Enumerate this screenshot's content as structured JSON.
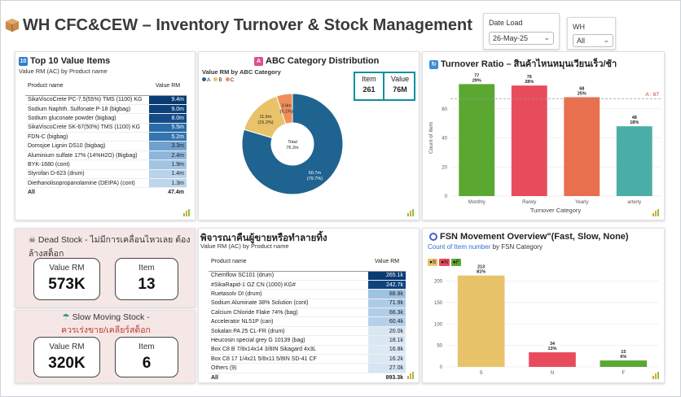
{
  "header": {
    "title": "WH CFC&CEW – Inventory Turnover & Stock Management",
    "icon": "box-icon"
  },
  "filters": {
    "date_label": "Date Load",
    "date_value": "26-May-25",
    "wh_label": "WH",
    "wh_value": "All"
  },
  "top10": {
    "title": "Top 10 Value Items",
    "subtitle": "Value RM (AC) by Product name",
    "col_product": "Product name",
    "col_value": "Value RM",
    "rows": [
      {
        "name": "SikaViscoCrete PC-7.5(55%) TMS (1100) KG",
        "value": "9.4m",
        "shade": "#0b3b73"
      },
      {
        "name": "Sodium Naphth. Sulfonate P-18 (bigbag)",
        "value": "9.0m",
        "shade": "#0e4079"
      },
      {
        "name": "Sodium gluconate powder (bigbag)",
        "value": "8.0m",
        "shade": "#134c87"
      },
      {
        "name": "SikaViscoCrete SK-67(50%) TMS (1100) KG",
        "value": "5.5m",
        "shade": "#2a6aa8"
      },
      {
        "name": "FDN-C (bigbag)",
        "value": "5.2m",
        "shade": "#3474b0"
      },
      {
        "name": "Domsjoe Lignin DS10 (bigbag)",
        "value": "3.3m",
        "shade": "#6fa1cf"
      },
      {
        "name": "Aluminium sulfate 17% (14%H2O) (Bigbag)",
        "value": "2.4m",
        "shade": "#8db6dc"
      },
      {
        "name": "BYK-1680 (cont)",
        "value": "1.9m",
        "shade": "#a3c5e4"
      },
      {
        "name": "Styrofan D-623 (drum)",
        "value": "1.4m",
        "shade": "#b8d3eb"
      },
      {
        "name": "Diethanolisopropanolamine (DEIPA) (cont)",
        "value": "1.3m",
        "shade": "#bcd6ec"
      }
    ],
    "total_label": "All",
    "total_value": "47.4m"
  },
  "abc": {
    "title": "ABC Category Distribution",
    "subtitle": "Value RM by ABC Category",
    "legend": [
      {
        "name": "A",
        "color": "#1f6391"
      },
      {
        "name": "B",
        "color": "#e8c36a"
      },
      {
        "name": "C",
        "color": "#ef8f5a"
      }
    ],
    "center_label": "Total",
    "center_value": "76.2m",
    "kpi_item_label": "Item",
    "kpi_item_value": "261",
    "kpi_value_label": "Value",
    "kpi_value_value": "76M"
  },
  "turnover": {
    "title": "Turnover Ratio – สินค้าไหนหมุนเวียนเร็ว/ช้า",
    "avg_label": "A : 67"
  },
  "dead_stock": {
    "title": "Dead Stock - ไม่มีการเคลื่อนไหวเลย ต้องล้างสต็อก",
    "value_label": "Value RM",
    "value": "573K",
    "item_label": "Item",
    "item_value": "13"
  },
  "slow_stock": {
    "title": "Slow Moving Stock -",
    "title2": "ควรเร่งขาย/เคลียร์สต็อก",
    "value_label": "Value RM",
    "value": "320K",
    "item_label": "Item",
    "item_value": "6"
  },
  "slow_table": {
    "title": "พิจารณาคืนผู้ขายหรือทำลายทิ้ง",
    "subtitle": "Value RM (AC) by Product name",
    "col_product": "Product name",
    "col_value": "Value RM",
    "rows": [
      {
        "name": "Chemflow SC101 (drum)",
        "value": "265.1k",
        "shade": "#0b3b73"
      },
      {
        "name": "#SikaRapid-1 GZ CN (1000) KG#",
        "value": "242.7k",
        "shade": "#0f437d"
      },
      {
        "name": "Ruetasolv DI (drum)",
        "value": "88.8k",
        "shade": "#9fc2e2"
      },
      {
        "name": "Sodium Aluminate 38% Solution (cont)",
        "value": "71.9k",
        "shade": "#accbe7"
      },
      {
        "name": "Calcium Chloride Flake 74% (bag)",
        "value": "66.3k",
        "shade": "#b0cee8"
      },
      {
        "name": "Accelerator NL51P (can)",
        "value": "60.4k",
        "shade": "#b5d1ea"
      },
      {
        "name": "Sokalan PA 25 CL-FR (drum)",
        "value": "20.0k",
        "shade": "#d8e7f4"
      },
      {
        "name": "Heucosin special grey G 10139 (bag)",
        "value": "18.1k",
        "shade": "#dae8f4"
      },
      {
        "name": "Box C8 B 7/8x14x14 3/8IN Sikagard 4x3L",
        "value": "16.8k",
        "shade": "#dbe9f5"
      },
      {
        "name": "Box C8 17 1/4x21 5/8x11 5/8IN SD-41 CF",
        "value": "16.2k",
        "shade": "#dce9f5"
      },
      {
        "name": "Others (9)",
        "value": "27.0k",
        "shade": "#d5e5f3"
      }
    ],
    "total_label": "All",
    "total_value": "893.3k"
  },
  "fsn": {
    "title": "FSN Movement Overview\"(Fast, Slow, None)",
    "subtitle_a": "Count of Item number",
    "subtitle_b": "by FSN Category",
    "legend": [
      {
        "name": "S",
        "color": "#e8c36a"
      },
      {
        "name": "N",
        "color": "#e84c5c"
      },
      {
        "name": "F",
        "color": "#5aa832"
      }
    ]
  },
  "chart_data": [
    {
      "type": "pie",
      "title": "ABC Category Distribution",
      "categories": [
        "A",
        "B",
        "C"
      ],
      "values": [
        60.7,
        11.6,
        3.9
      ],
      "value_labels": [
        "60.7m",
        "11.6m",
        "3.9m"
      ],
      "percent_labels": [
        "(79.7%)",
        "(15.2%)",
        "(5.1%)"
      ],
      "colors": [
        "#1f6391",
        "#e8c36a",
        "#ef8f5a"
      ]
    },
    {
      "type": "bar",
      "title": "Turnover Ratio",
      "xlabel": "Turnover Category",
      "ylabel": "Count of Item",
      "categories": [
        "Monthly",
        "Rarely",
        "Yearly",
        "arterly"
      ],
      "values": [
        77,
        76,
        68,
        48
      ],
      "percent_labels": [
        "29%",
        "28%",
        "25%",
        "18%"
      ],
      "colors": [
        "#5aa832",
        "#e84c5c",
        "#e8704e",
        "#4aaea6"
      ],
      "average": 67,
      "ylim": [
        0,
        80
      ],
      "yticks": [
        0,
        20,
        40,
        60
      ]
    },
    {
      "type": "bar",
      "title": "FSN Movement Overview",
      "categories": [
        "S",
        "N",
        "F"
      ],
      "values": [
        213,
        34,
        15
      ],
      "percent_labels": [
        "81%",
        "13%",
        "6%"
      ],
      "colors": [
        "#e8c36a",
        "#e84c5c",
        "#5aa832"
      ],
      "ylim": [
        0,
        220
      ],
      "yticks": [
        0,
        50,
        100,
        150,
        200
      ]
    }
  ]
}
